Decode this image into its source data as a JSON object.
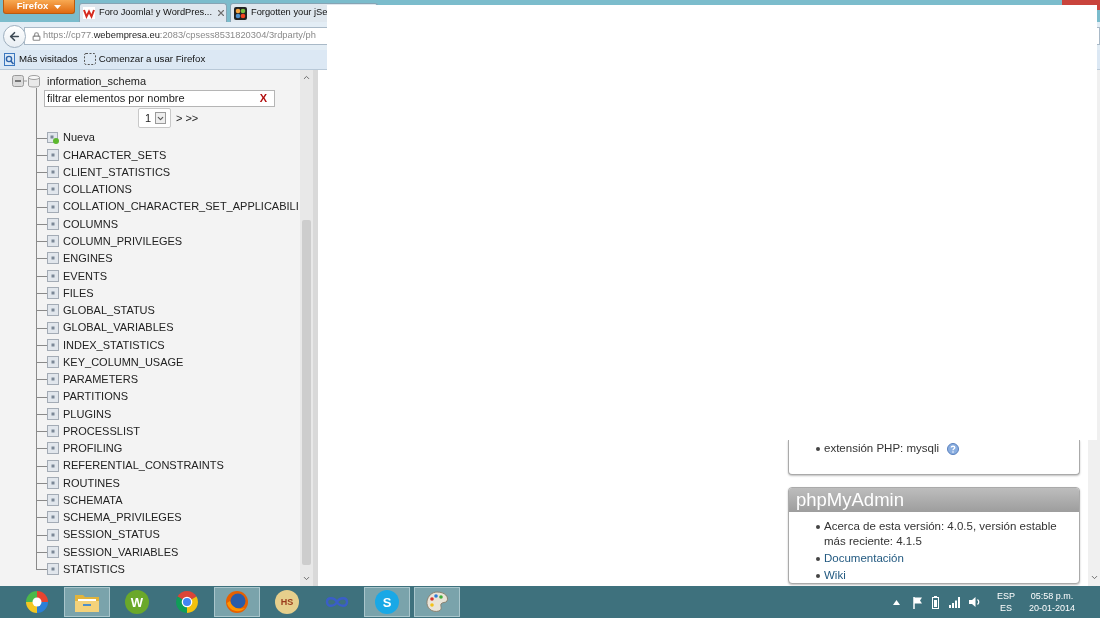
{
  "browser": {
    "menu_button": "Firefox",
    "tabs": [
      {
        "kind": "zigzag",
        "title": "Foro Joomla! y WordPres...",
        "closable": true
      },
      {
        "kind": "quad",
        "title": "Forgotten your jSe",
        "closable": false
      }
    ],
    "url": {
      "scheme_and_subdomain": "https://cp77.",
      "domain": "webempresa.eu",
      "path": ":2083/cpsess8531820304/3rdparty/ph"
    },
    "bookmarks": [
      {
        "kind": "smart",
        "label": "Más visitados"
      },
      {
        "kind": "blank",
        "label": "Comenzar a usar Firefox"
      }
    ]
  },
  "navigation": {
    "database": {
      "name": "information_schema",
      "expanded": true
    },
    "filter": {
      "placeholder": "filtrar elementos por nombre",
      "clear": "X"
    },
    "pagination": {
      "page": "1",
      "next": ">",
      "last": ">>"
    },
    "items": [
      {
        "kind": "new",
        "name": "Nueva"
      },
      {
        "kind": "table",
        "name": "CHARACTER_SETS"
      },
      {
        "kind": "table",
        "name": "CLIENT_STATISTICS"
      },
      {
        "kind": "table",
        "name": "COLLATIONS"
      },
      {
        "kind": "table",
        "name": "COLLATION_CHARACTER_SET_APPLICABILI"
      },
      {
        "kind": "table",
        "name": "COLUMNS"
      },
      {
        "kind": "table",
        "name": "COLUMN_PRIVILEGES"
      },
      {
        "kind": "table",
        "name": "ENGINES"
      },
      {
        "kind": "table",
        "name": "EVENTS"
      },
      {
        "kind": "table",
        "name": "FILES"
      },
      {
        "kind": "table",
        "name": "GLOBAL_STATUS"
      },
      {
        "kind": "table",
        "name": "GLOBAL_VARIABLES"
      },
      {
        "kind": "table",
        "name": "INDEX_STATISTICS"
      },
      {
        "kind": "table",
        "name": "KEY_COLUMN_USAGE"
      },
      {
        "kind": "table",
        "name": "PARAMETERS"
      },
      {
        "kind": "table",
        "name": "PARTITIONS"
      },
      {
        "kind": "table",
        "name": "PLUGINS"
      },
      {
        "kind": "table",
        "name": "PROCESSLIST"
      },
      {
        "kind": "table",
        "name": "PROFILING"
      },
      {
        "kind": "table",
        "name": "REFERENTIAL_CONSTRAINTS"
      },
      {
        "kind": "table",
        "name": "ROUTINES"
      },
      {
        "kind": "table",
        "name": "SCHEMATA"
      },
      {
        "kind": "table",
        "name": "SCHEMA_PRIVILEGES"
      },
      {
        "kind": "table",
        "name": "SESSION_STATUS"
      },
      {
        "kind": "table",
        "name": "SESSION_VARIABLES"
      },
      {
        "kind": "table",
        "name": "STATISTICS"
      }
    ]
  },
  "main": {
    "panels": [
      {
        "items": [
          {
            "kind": "info",
            "text": "extensión PHP: mysqli"
          }
        ]
      },
      {
        "title": "phpMyAdmin",
        "items": [
          {
            "kind": "text",
            "text": "Acerca de esta versión: 4.0.5, versión estable más reciente: 4.1.5"
          },
          {
            "kind": "link",
            "text": "Documentación"
          },
          {
            "kind": "link",
            "text": "Wiki"
          }
        ]
      }
    ]
  },
  "taskbar": {
    "apps": [
      {
        "kind": "orb",
        "running": false
      },
      {
        "kind": "explorer",
        "running": true
      },
      {
        "kind": "lettered",
        "label": "W",
        "color": "#6aa82a",
        "running": false
      },
      {
        "kind": "ring",
        "running": false
      },
      {
        "kind": "globe",
        "running": true
      },
      {
        "kind": "lettered",
        "label": "HS",
        "color": "#e6cf8c",
        "running": false
      },
      {
        "kind": "loop",
        "running": false
      },
      {
        "kind": "lettered",
        "label": "S",
        "color": "#19a8e6",
        "running": true
      },
      {
        "kind": "palette",
        "running": true
      }
    ],
    "tray": {
      "language": "ESP",
      "keyboard": "ES",
      "time": "05:58 p.m.",
      "date": "20-01-2014"
    }
  }
}
